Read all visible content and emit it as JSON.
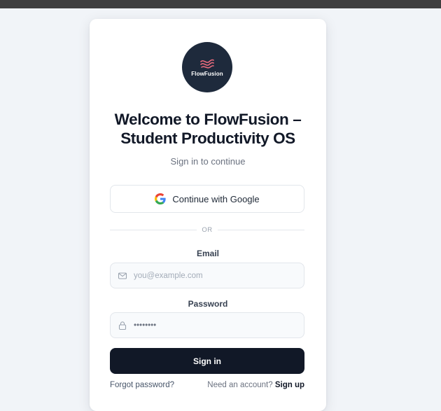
{
  "colors": {
    "background": "#f1f4f8",
    "card": "#ffffff",
    "logo_bg": "#1e2a3c",
    "logo_accent": "#e86a7c",
    "primary_button": "#111827"
  },
  "logo": {
    "text": "FlowFusion"
  },
  "header": {
    "title_line1": "Welcome to FlowFusion –",
    "title_line2": "Student Productivity OS",
    "subtitle": "Sign in to continue"
  },
  "google_button": {
    "label": "Continue with Google",
    "icon": "google-icon"
  },
  "divider": {
    "label": "OR"
  },
  "email": {
    "label": "Email",
    "placeholder": "you@example.com",
    "icon": "mail-icon"
  },
  "password": {
    "label": "Password",
    "value": "••••••••",
    "icon": "lock-icon"
  },
  "signin_button": {
    "label": "Sign in"
  },
  "footer": {
    "forgot_label": "Forgot password?",
    "signup_prompt": "Need an account?",
    "signup_label": "Sign up"
  }
}
